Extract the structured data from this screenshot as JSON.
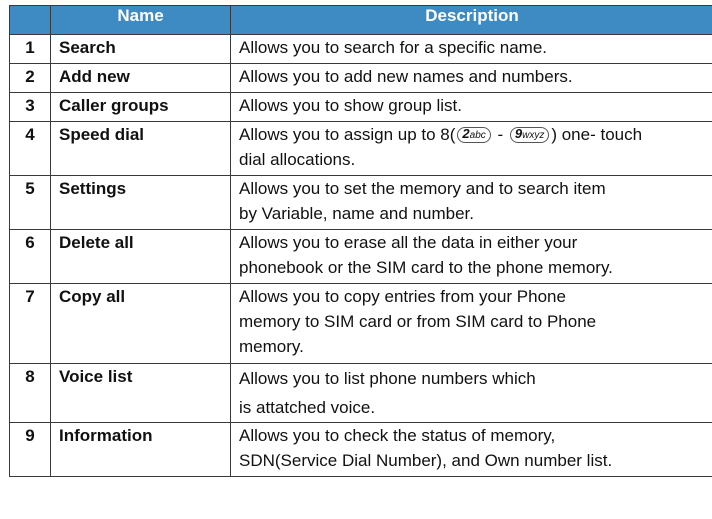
{
  "table": {
    "headers": {
      "number": "",
      "name": "Name",
      "description": "Description"
    },
    "rows": [
      {
        "num": "1",
        "name": "Search",
        "desc": [
          "Allows you to search for a specific name."
        ]
      },
      {
        "num": "2",
        "name": "Add new",
        "desc": [
          "Allows you to add new names and numbers."
        ]
      },
      {
        "num": "3",
        "name": "Caller groups",
        "desc": [
          "Allows you to show group list."
        ]
      },
      {
        "num": "4",
        "name": "Speed dial",
        "desc_prefix": "Allows you to assign up to 8(",
        "key_from": {
          "digit": "2",
          "letters": "abc"
        },
        "dash": " - ",
        "key_to": {
          "digit": "9",
          "letters": "wxyz"
        },
        "desc_suffix": ") one- touch",
        "desc_line2": "dial allocations."
      },
      {
        "num": "5",
        "name": "Settings",
        "desc": [
          "Allows you to set the memory and to search item",
          "by Variable, name and number."
        ]
      },
      {
        "num": "6",
        "name": "Delete all",
        "desc": [
          "Allows you to erase all the data in either your",
          "phonebook or the SIM card to the phone memory."
        ]
      },
      {
        "num": "7",
        "name": "Copy all",
        "desc": [
          "Allows you to copy entries from your Phone",
          "memory to SIM card or from SIM card to Phone",
          "memory."
        ]
      },
      {
        "num": "8",
        "name": "Voice list",
        "desc": [
          "Allows you to list phone numbers which",
          "is attatched voice."
        ]
      },
      {
        "num": "9",
        "name": "Information",
        "desc": [
          "Allows you to check the status of memory,",
          "SDN(Service Dial Number), and Own number list."
        ]
      }
    ]
  }
}
